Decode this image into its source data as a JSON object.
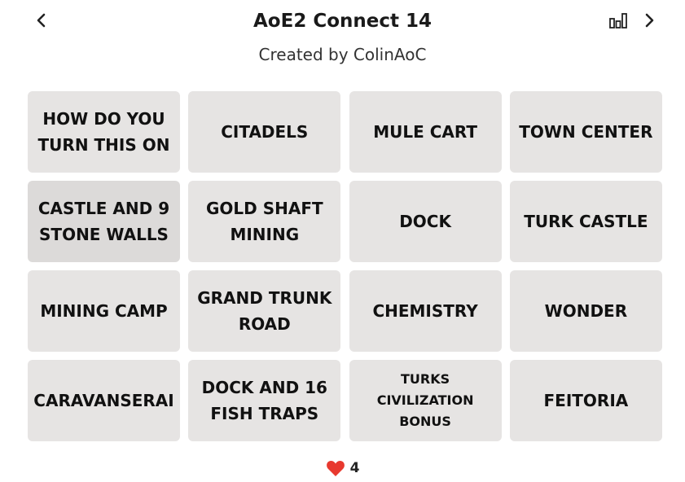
{
  "header": {
    "title": "AoE2 Connect 14",
    "subtitle": "Created by ColinAoC",
    "icons": {
      "back": "chevron-left-icon",
      "stats": "bar-chart-icon",
      "next": "chevron-right-icon"
    }
  },
  "tiles": [
    "HOW DO YOU TURN THIS ON",
    "CITADELS",
    "MULE CART",
    "TOWN CENTER",
    "CASTLE AND 9 STONE WALLS",
    "GOLD SHAFT MINING",
    "DOCK",
    "TURK CASTLE",
    "MINING CAMP",
    "GRAND TRUNK ROAD",
    "CHEMISTRY",
    "WONDER",
    "CARAVANSERAI",
    "DOCK AND 16 FISH TRAPS",
    "TURKS CIVILIZATION BONUS",
    "FEITORIA"
  ],
  "lives": {
    "count": "4",
    "icon": "heart-icon",
    "color": "#e8392f"
  },
  "colors": {
    "tile_background": "#e6e4e3",
    "tile_selected": "#dcdad9"
  }
}
